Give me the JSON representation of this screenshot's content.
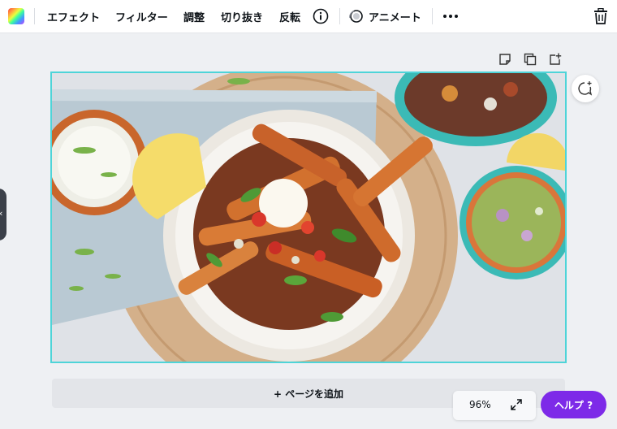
{
  "toolbar": {
    "effects": "エフェクト",
    "filter": "フィルター",
    "adjust": "調整",
    "crop": "切り抜き",
    "flip": "反転",
    "animate": "アニメート"
  },
  "footer": {
    "add_page": "+ ページを追加",
    "zoom": "96%",
    "help": "ヘルプ ?"
  },
  "colors": {
    "accent": "#7d2ae8",
    "selection": "#4ed4d8"
  }
}
